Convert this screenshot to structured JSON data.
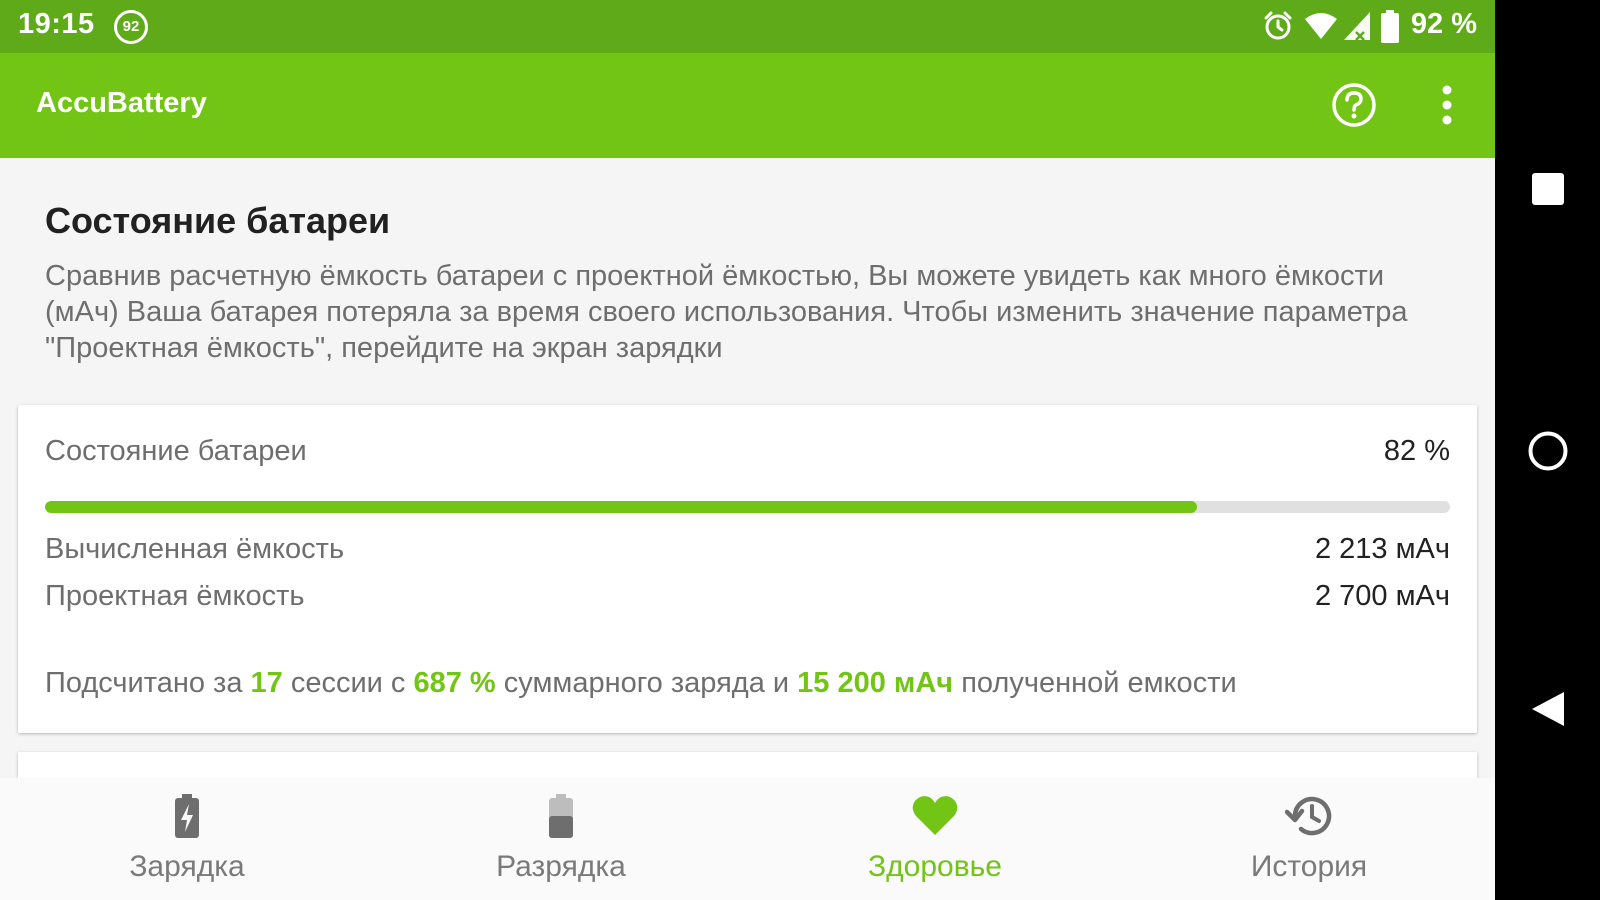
{
  "status_bar": {
    "time": "19:15",
    "notification_badge": "92",
    "battery_percent": "92 %",
    "icons": [
      "alarm-icon",
      "wifi-icon",
      "cell-signal-icon",
      "battery-icon"
    ]
  },
  "app_bar": {
    "title": "AccuBattery",
    "actions": [
      "help-icon",
      "more-vert-icon"
    ]
  },
  "health": {
    "section_title": "Состояние батареи",
    "description": "Сравнив расчетную ёмкость батареи с проектной ёмкостью, Вы можете увидеть как много ёмкости (мАч) Ваша батарея потеряла за время своего использования. Чтобы изменить значение параметра \"Проектная ёмкость\", перейдите на экран зарядки",
    "card": {
      "health_label": "Состояние батареи",
      "health_value": "82 %",
      "health_fraction": 0.82,
      "calculated_label": "Вычисленная ёмкость",
      "calculated_value": "2 213 мАч",
      "design_label": "Проектная ёмкость",
      "design_value": "2 700 мАч",
      "summary": {
        "part1": "Подсчитано за ",
        "sessions": "17",
        "part2": " сессии с ",
        "charge": "687 %",
        "part3": " суммарного заряда и ",
        "capacity": "15 200 мАч",
        "part4": " полученной емкости"
      }
    }
  },
  "bottom_nav": {
    "items": [
      {
        "label": "Зарядка",
        "icon": "battery-charging-icon",
        "active": false
      },
      {
        "label": "Разрядка",
        "icon": "battery-discharging-icon",
        "active": false
      },
      {
        "label": "Здоровье",
        "icon": "heart-icon",
        "active": true
      },
      {
        "label": "История",
        "icon": "history-icon",
        "active": false
      }
    ]
  },
  "colors": {
    "status_bar": "#5faa19",
    "app_bar": "#72c415",
    "accent": "#72c415",
    "progress_track": "#e0e0e0"
  },
  "system_nav": [
    "recents-button",
    "home-button",
    "back-button"
  ]
}
